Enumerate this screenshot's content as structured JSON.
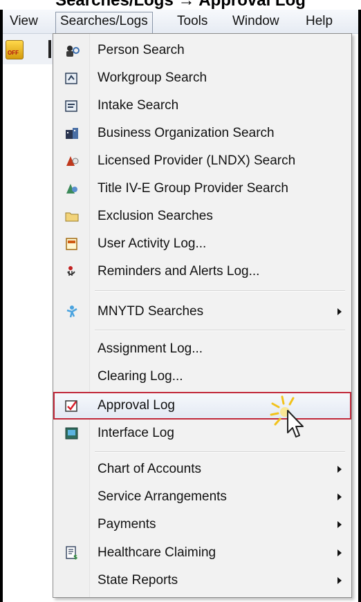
{
  "header": {
    "title_fragment": "Searches/Logs → Approval Log"
  },
  "menubar": {
    "items": [
      {
        "label": "View",
        "open": false
      },
      {
        "label": "Searches/Logs",
        "open": true
      },
      {
        "label": "Tools",
        "open": false
      },
      {
        "label": "Window",
        "open": false
      },
      {
        "label": "Help",
        "open": false
      }
    ]
  },
  "toolbar": {
    "key_button_text": "OFF"
  },
  "menu": {
    "items": [
      {
        "label": "Person Search",
        "icon": "person-search-icon"
      },
      {
        "label": "Workgroup Search",
        "icon": "workgroup-search-icon"
      },
      {
        "label": "Intake Search",
        "icon": "intake-search-icon"
      },
      {
        "label": "Business Organization Search",
        "icon": "business-org-icon"
      },
      {
        "label": "Licensed Provider (LNDX) Search",
        "icon": "licensed-provider-icon"
      },
      {
        "label": "Title IV-E Group Provider Search",
        "icon": "group-provider-icon"
      },
      {
        "label": "Exclusion Searches",
        "icon": "folder-icon"
      },
      {
        "label": "User Activity Log...",
        "icon": "log-icon"
      },
      {
        "label": "Reminders and Alerts Log...",
        "icon": "alert-icon"
      },
      {
        "label": "MNYTD Searches",
        "icon": "mnytd-person-icon",
        "submenu": true
      },
      {
        "label": "Assignment Log..."
      },
      {
        "label": "Clearing Log..."
      },
      {
        "label": "Approval Log",
        "icon": "approval-check-icon",
        "highlighted": true
      },
      {
        "label": "Interface Log",
        "icon": "interface-log-icon"
      },
      {
        "label": "Chart of Accounts",
        "submenu": true
      },
      {
        "label": "Service Arrangements",
        "submenu": true
      },
      {
        "label": "Payments",
        "submenu": true
      },
      {
        "label": "Healthcare Claiming",
        "icon": "healthcare-document-icon",
        "submenu": true
      },
      {
        "label": "State Reports",
        "submenu": true
      }
    ]
  },
  "colors": {
    "highlight_border": "#c0283a",
    "menu_bg": "#f2f2f2"
  }
}
